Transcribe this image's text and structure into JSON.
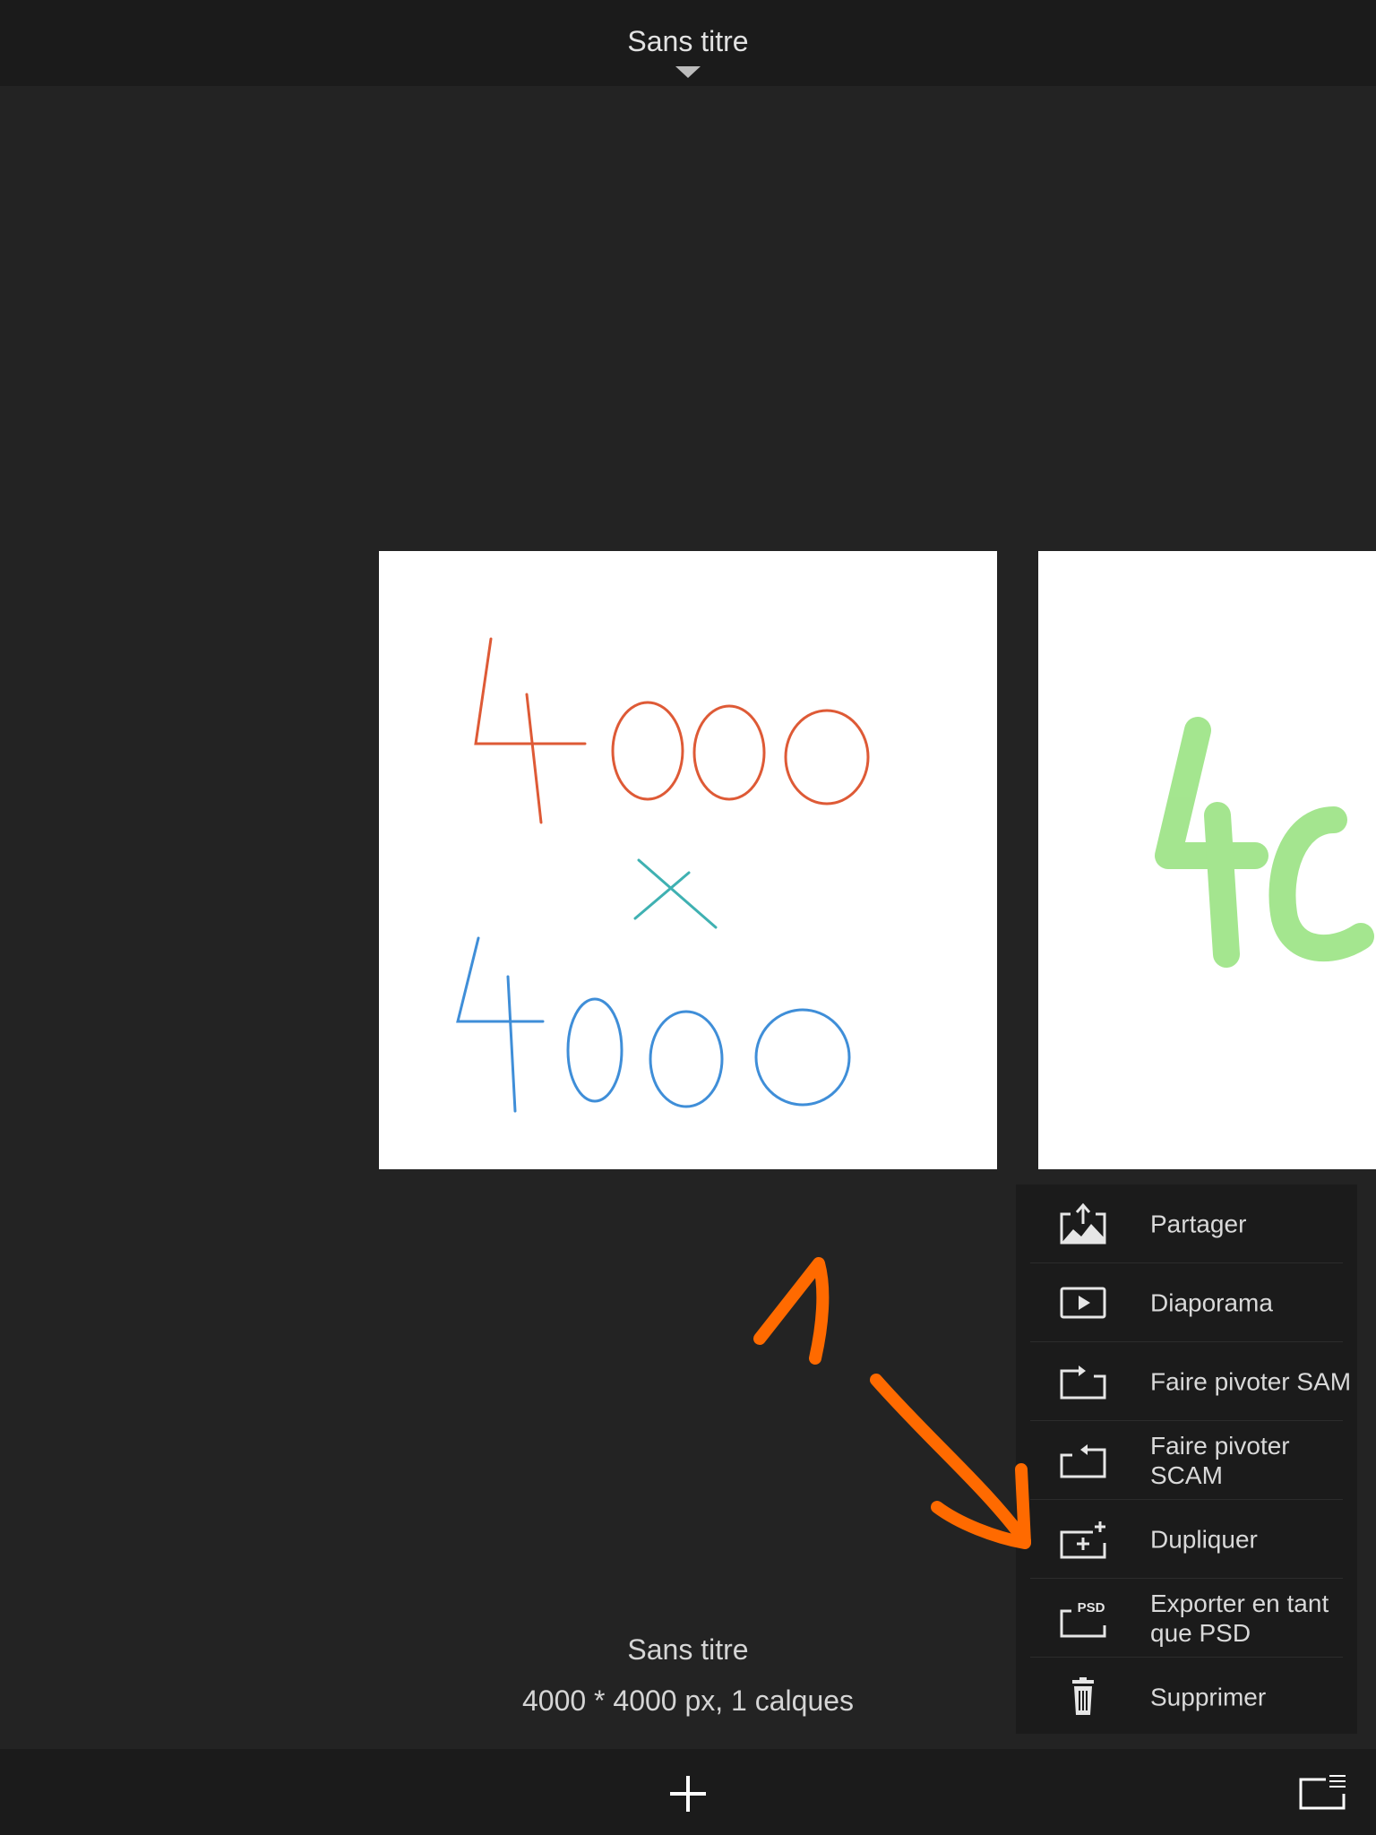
{
  "header": {
    "title": "Sans titre"
  },
  "gallery": {
    "current": {
      "name": "Sans titre",
      "details": "4000 * 4000 px, 1 calques"
    }
  },
  "context_menu": {
    "items": [
      {
        "label": "Partager",
        "icon": "share-image-icon"
      },
      {
        "label": "Diaporama",
        "icon": "slideshow-play-icon"
      },
      {
        "label": "Faire pivoter SAM",
        "icon": "rotate-clockwise-icon"
      },
      {
        "label": "Faire pivoter SCAM",
        "icon": "rotate-counterclockwise-icon"
      },
      {
        "label": "Dupliquer",
        "icon": "duplicate-icon"
      },
      {
        "label": "Exporter en tant que PSD",
        "icon": "export-psd-icon"
      },
      {
        "label": "Supprimer",
        "icon": "trash-icon"
      }
    ],
    "psd_badge": "PSD"
  },
  "toolbar": {
    "add_icon": "plus-icon",
    "list_icon": "list-view-icon"
  },
  "colors": {
    "background": "#232323",
    "bars": "#1b1b1b",
    "text": "#d9d9d9",
    "annotation": "#ff6a00"
  }
}
